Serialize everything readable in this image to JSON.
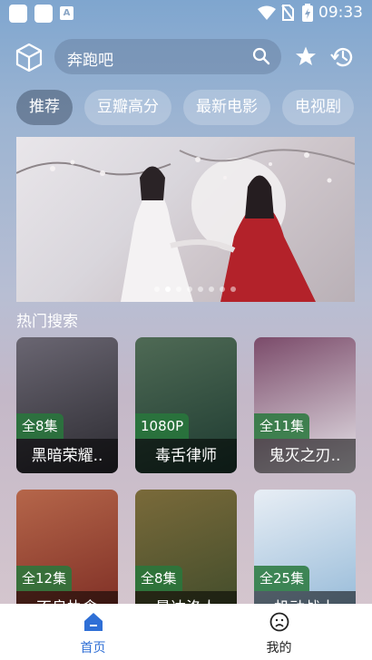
{
  "status_bar": {
    "time": "09:33",
    "indicator": "A"
  },
  "search": {
    "text": "奔跑吧"
  },
  "chips": [
    "推荐",
    "豆瓣高分",
    "最新电影",
    "电视剧"
  ],
  "section_title": "热门搜索",
  "cards_row1": [
    {
      "badge": "全8集",
      "title": "黑暗荣耀..",
      "color1": "#2b2a30",
      "color2": "#6a6672"
    },
    {
      "badge": "1080P",
      "title": "毒舌律师",
      "color1": "#1d3a30",
      "color2": "#4f6a55"
    },
    {
      "badge": "全11集",
      "title": "鬼灭之刃..",
      "color1": "#e7e5ea",
      "color2": "#7b4b6a"
    }
  ],
  "cards_row2": [
    {
      "badge": "全12集",
      "title": "不良执念",
      "color1": "#7a2a22",
      "color2": "#b5664a"
    },
    {
      "badge": "全8集",
      "title": "曼达洛人",
      "color1": "#3d4a2a",
      "color2": "#7a6a3a"
    },
    {
      "badge": "全25集",
      "title": "机动战士",
      "color1": "#8fb6d6",
      "color2": "#e8eef5"
    }
  ],
  "bottom_nav": {
    "home": "首页",
    "mine": "我的"
  },
  "colors": {
    "accent": "#2f6fd6",
    "badge": "#2e7c45"
  }
}
